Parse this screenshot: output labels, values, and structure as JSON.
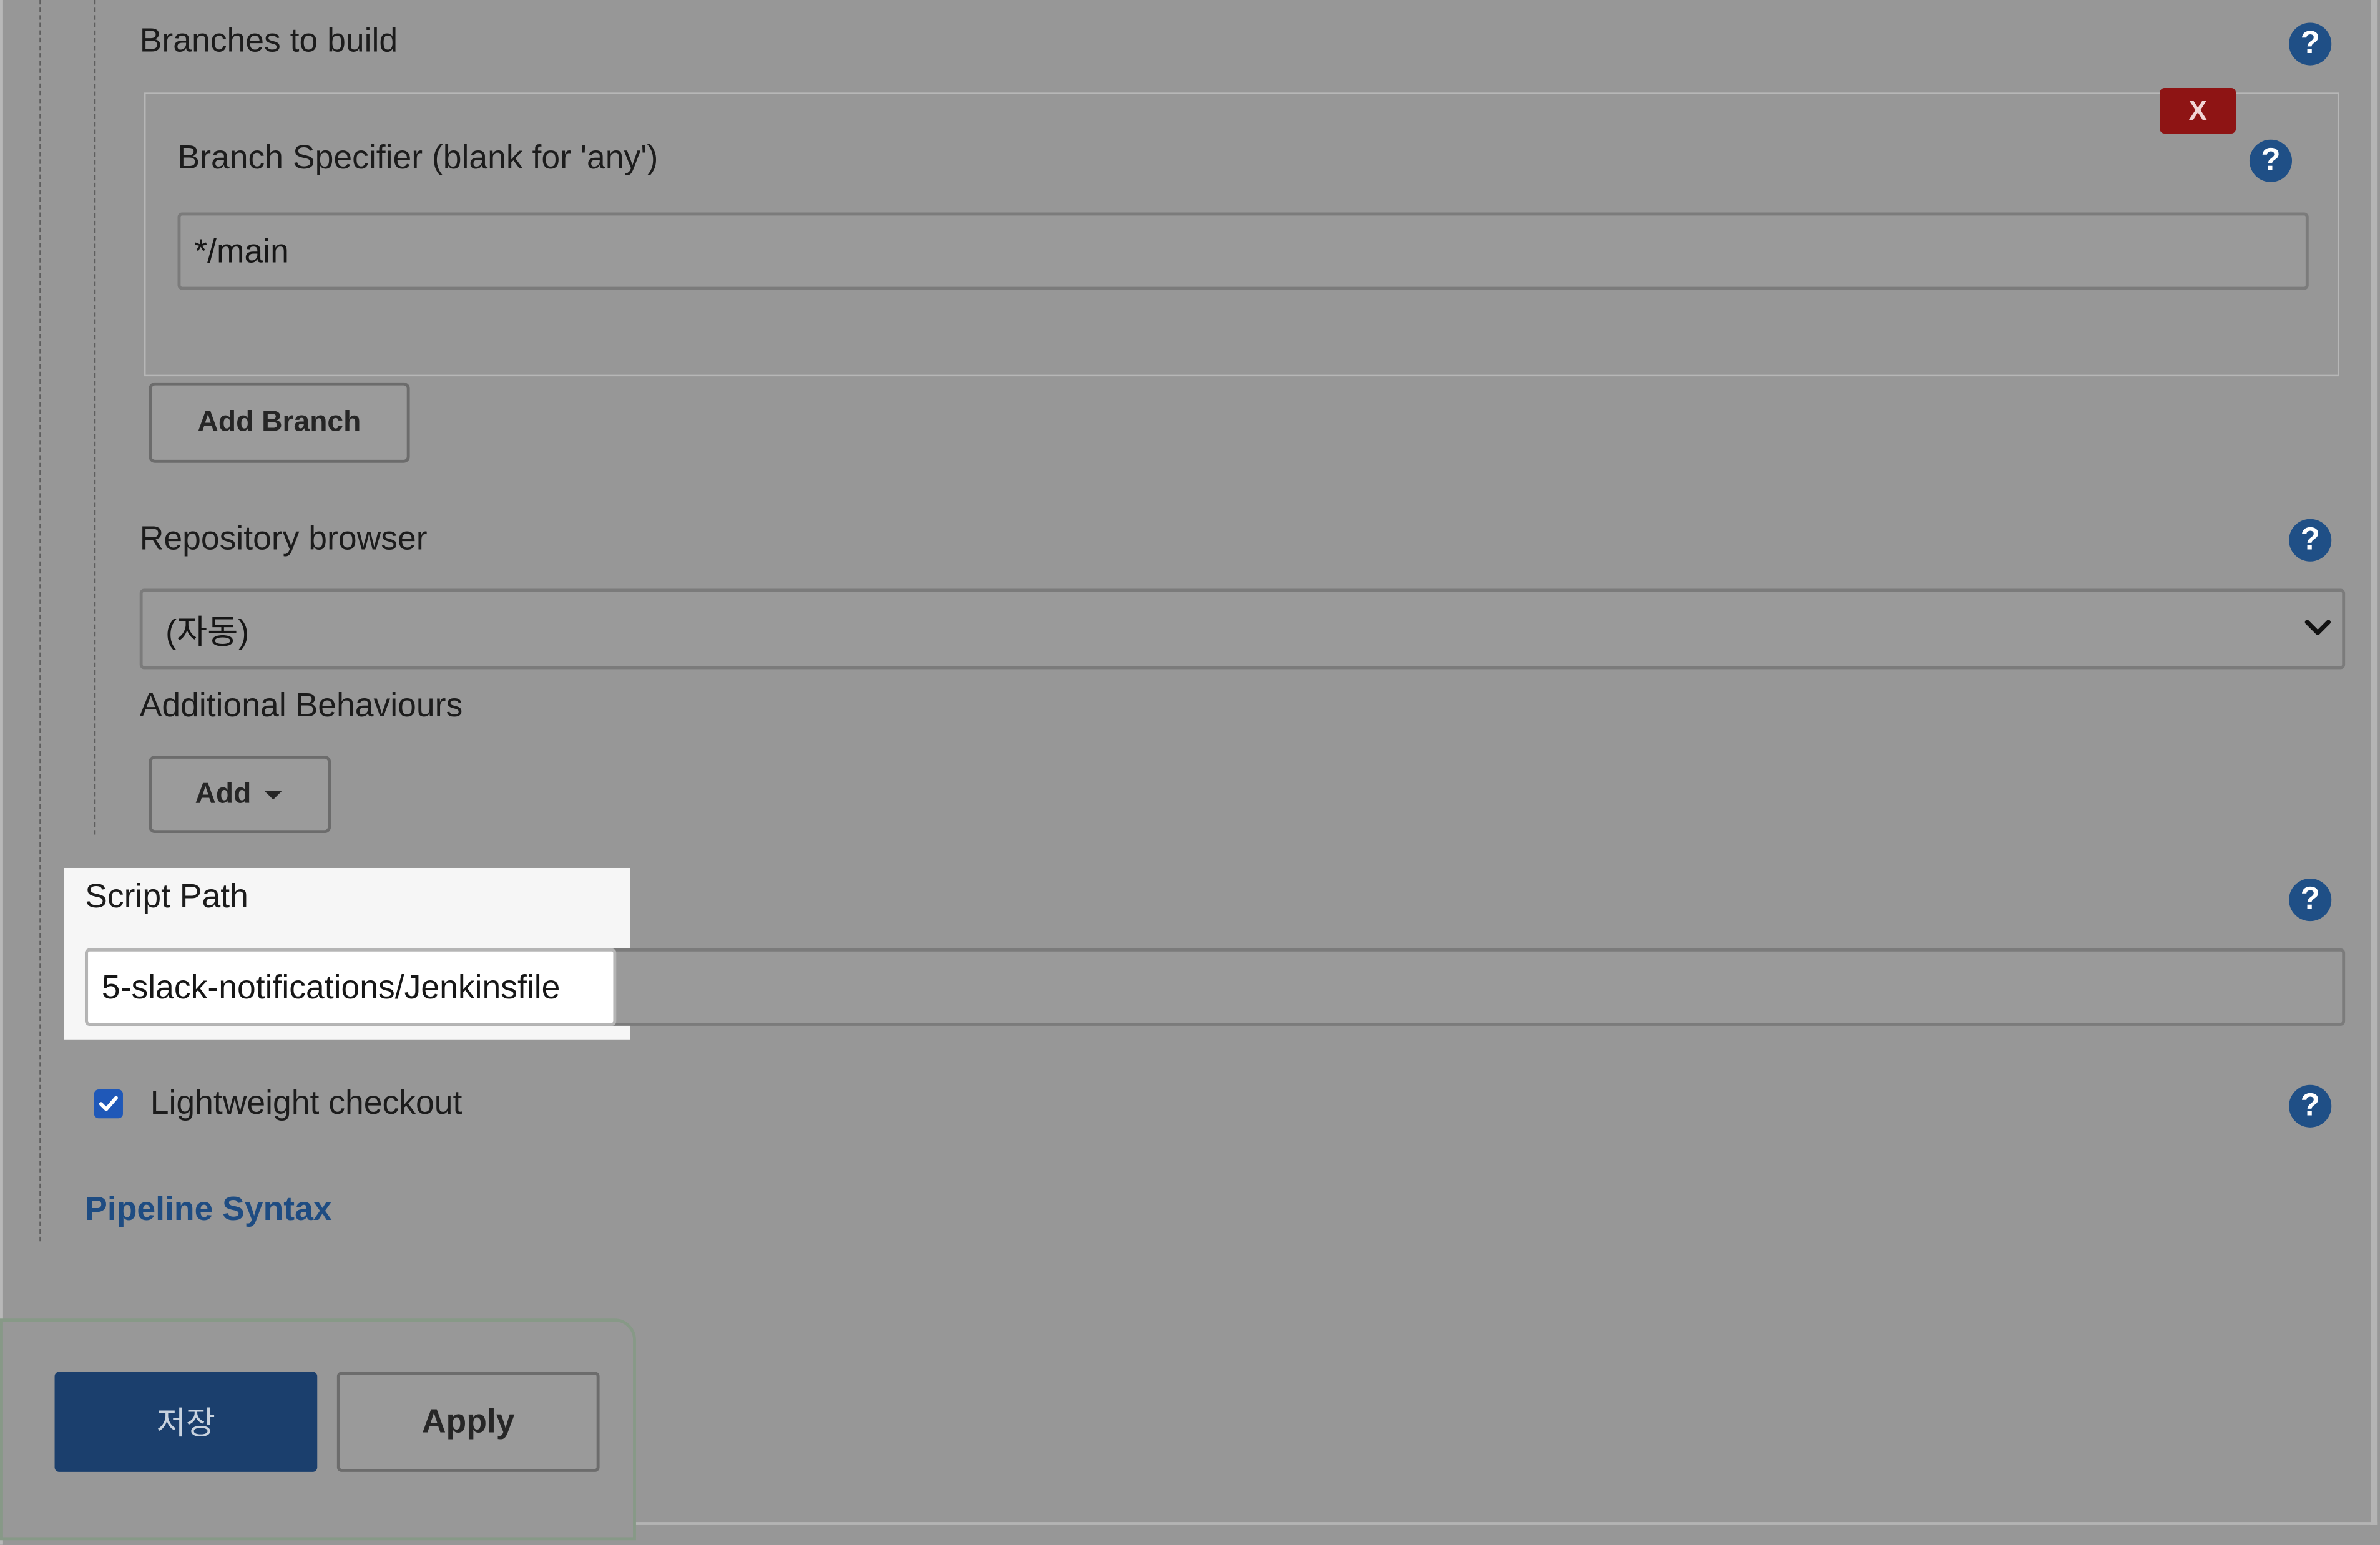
{
  "branches": {
    "section_label": "Branches to build",
    "specifier_label": "Branch Specifier (blank for 'any')",
    "specifier_value": "*/main",
    "delete_label": "X",
    "add_branch_label": "Add Branch"
  },
  "repository_browser": {
    "label": "Repository browser",
    "selected": "(자동)"
  },
  "additional_behaviours": {
    "label": "Additional Behaviours",
    "add_label": "Add"
  },
  "script_path": {
    "label": "Script Path",
    "value": "5-slack-notifications/Jenkinsfile"
  },
  "lightweight_checkout": {
    "label": "Lightweight checkout",
    "checked": true
  },
  "pipeline_syntax": {
    "label": "Pipeline Syntax"
  },
  "footer": {
    "save_label": "저장",
    "apply_label": "Apply"
  },
  "help": {
    "glyph": "?"
  },
  "colors": {
    "help_icon": "#1f4f86",
    "delete_button": "#8e1414",
    "save_button": "#1b3f6d",
    "link": "#1e4c82",
    "checkbox": "#1f58b8"
  }
}
